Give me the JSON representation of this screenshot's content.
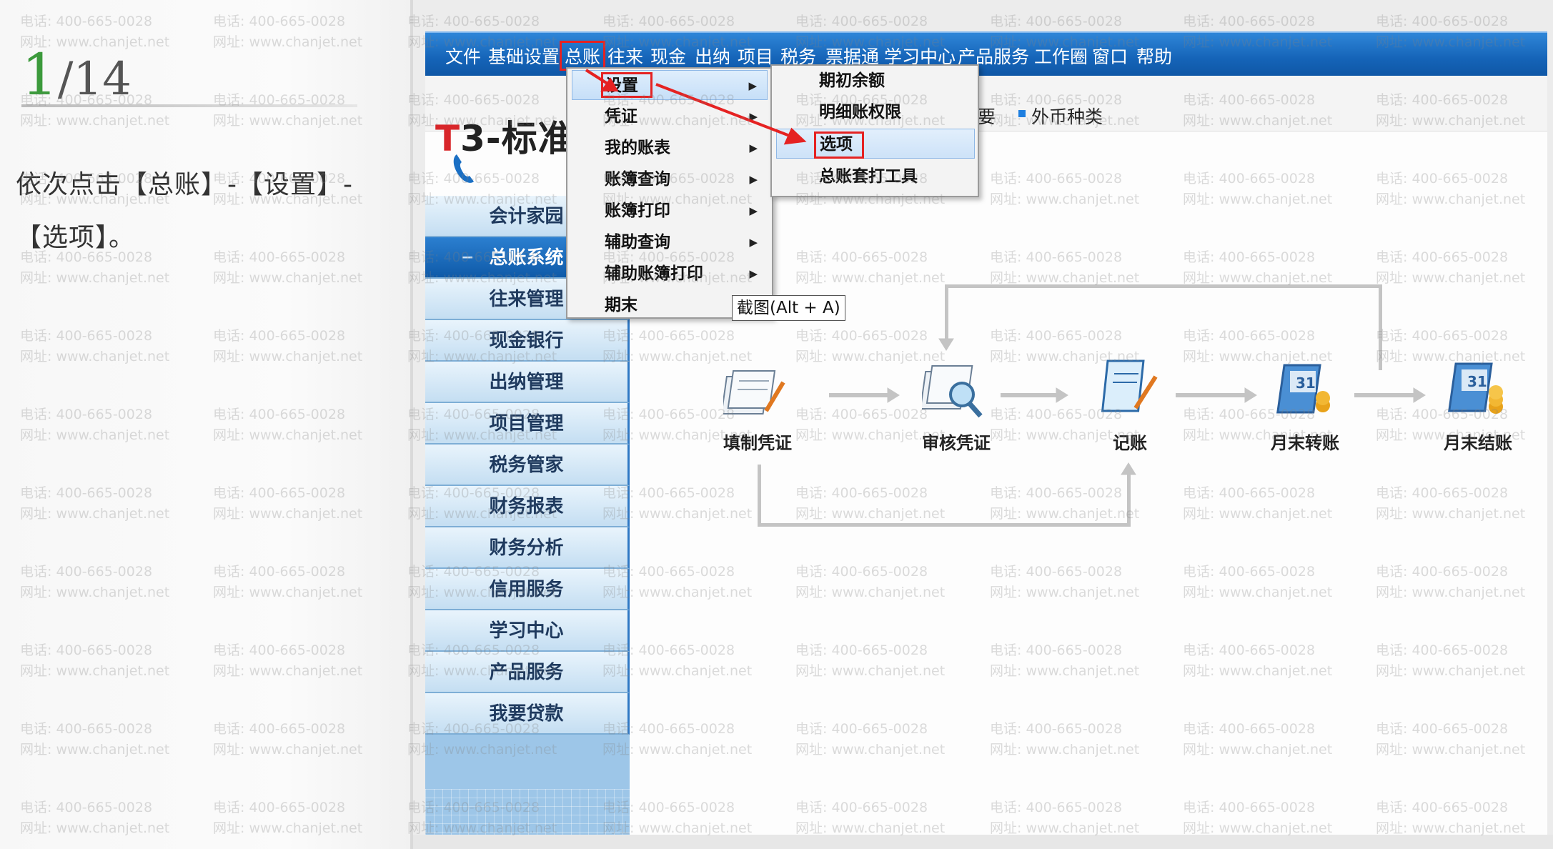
{
  "tutorial": {
    "step_current": "1",
    "step_total": "/14",
    "instruction": "依次点击【总账】-【设置】-【选项】。"
  },
  "watermark": {
    "phone": "电话: 400-665-0028",
    "site": "网址: www.chanjet.net"
  },
  "menubar": {
    "items": [
      "文件",
      "基础设置",
      "总账",
      "往来",
      "现金",
      "出纳",
      "项目",
      "税务",
      "票据通",
      "学习中心",
      "产品服务",
      "工作圈",
      "窗口",
      "帮助"
    ]
  },
  "toolbar": {
    "partial_item": "要",
    "currency_item": "外币种类"
  },
  "logo": {
    "prefix": "T",
    "rest": "3-标准"
  },
  "sidebar": {
    "items": [
      "会计家园",
      "总账系统",
      "往来管理",
      "现金银行",
      "出纳管理",
      "项目管理",
      "税务管家",
      "财务报表",
      "财务分析",
      "信用服务",
      "学习中心",
      "产品服务",
      "我要贷款"
    ],
    "active_index": 1
  },
  "menu_zongzhang": {
    "items": [
      "设置",
      "凭证",
      "我的账表",
      "账簿查询",
      "账簿打印",
      "辅助查询",
      "辅助账簿打印",
      "期末"
    ]
  },
  "menu_settings": {
    "items": [
      "期初余额",
      "明细账权限",
      "选项",
      "总账套打工具"
    ]
  },
  "tooltip": {
    "text": "截图(Alt + A)"
  },
  "flow": {
    "nodes": [
      "填制凭证",
      "审核凭证",
      "记账",
      "月末转账",
      "月末结账"
    ]
  },
  "colors": {
    "menubar": "#1564b8",
    "highlight_box": "#e52222",
    "sidebar_active": "#0f5aa8",
    "step_green": "#3c9a3c"
  }
}
